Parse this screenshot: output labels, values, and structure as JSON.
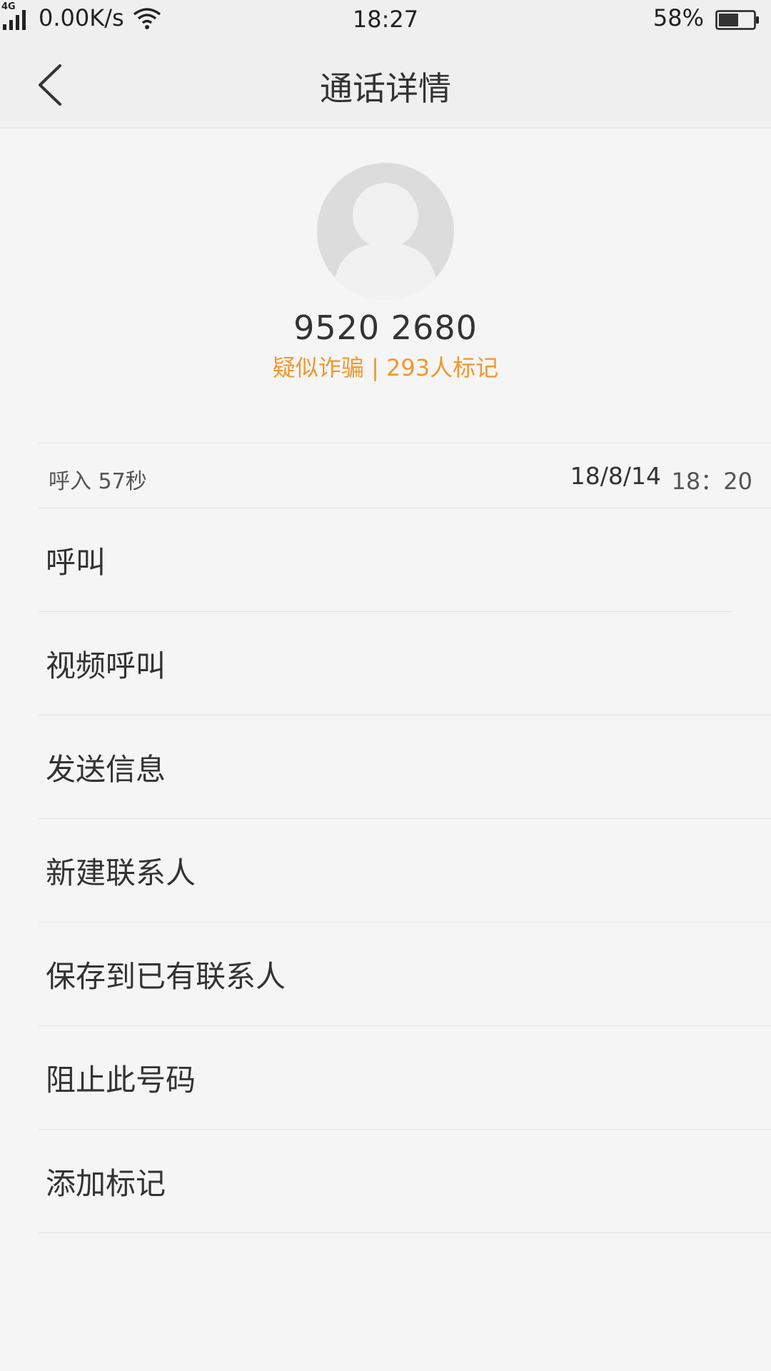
{
  "status_bar": {
    "network_type": "4G",
    "speed": "0.00K/s",
    "time": "18:27",
    "battery_percent": "58%",
    "battery_level": 0.58
  },
  "header": {
    "title": "通话详情",
    "back_icon": "chevron-left-icon"
  },
  "contact": {
    "avatar_icon": "person-icon",
    "number": "9520 2680",
    "tag": "疑似诈骗 | 293人标记"
  },
  "call_record": {
    "type_duration": "呼入 57秒",
    "date": "18/8/14",
    "time": "18：20"
  },
  "menu": [
    {
      "label": "呼叫"
    },
    {
      "label": "视频呼叫"
    },
    {
      "label": "发送信息"
    },
    {
      "label": "新建联系人"
    },
    {
      "label": "保存到已有联系人"
    },
    {
      "label": "阻止此号码"
    },
    {
      "label": "添加标记"
    }
  ],
  "colors": {
    "accent_orange": "#f0982f",
    "background": "#f5f5f5",
    "header_bg": "#efefef"
  }
}
